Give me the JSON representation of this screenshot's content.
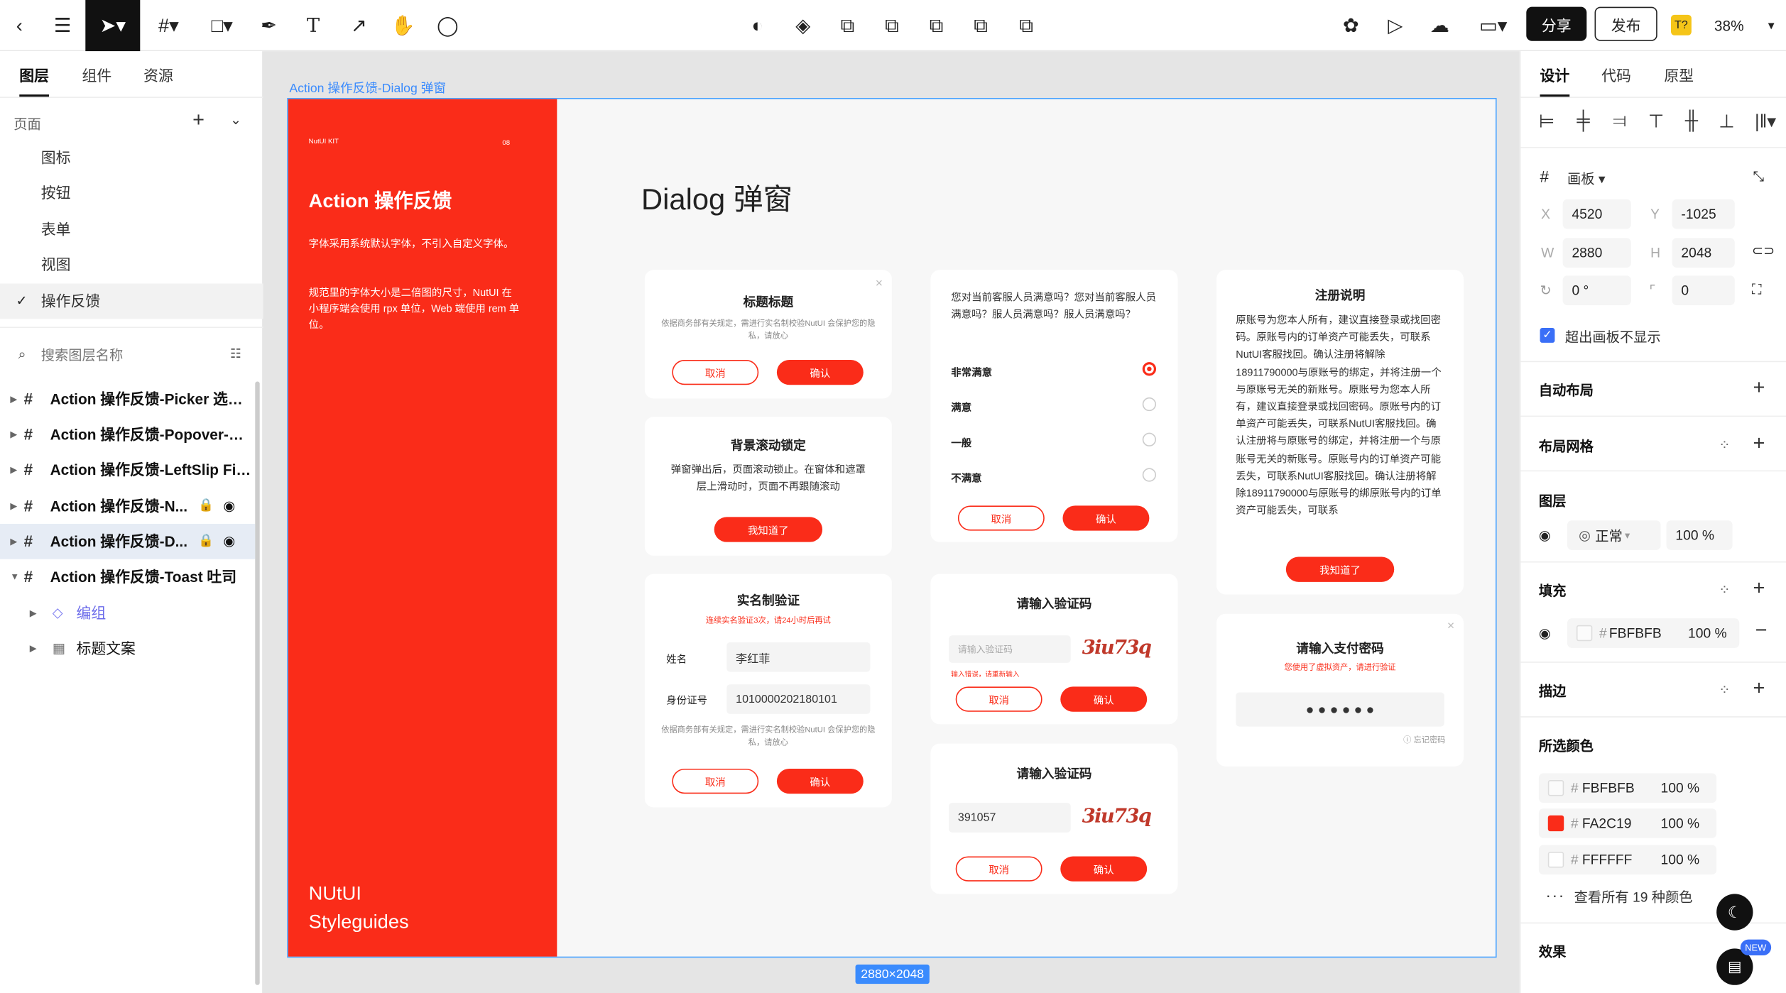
{
  "toolbar": {
    "share": "分享",
    "publish": "发布",
    "zoom": "38%",
    "user_badge": "T?"
  },
  "left": {
    "tabs": [
      "图层",
      "组件",
      "资源"
    ],
    "pages_label": "页面",
    "pages": [
      "图标",
      "按钮",
      "表单",
      "视图",
      "操作反馈"
    ],
    "search_placeholder": "搜索图层名称",
    "layers": [
      "Action 操作反馈-Picker 选择器",
      "Action 操作反馈-Popover-气...",
      "Action 操作反馈-LeftSlip Fixe...",
      "Action 操作反馈-N...",
      "Action 操作反馈-D...",
      "Action 操作反馈-Toast 吐司"
    ],
    "sublayers": [
      "编组",
      "标题文案"
    ]
  },
  "canvas": {
    "board_label": "Action 操作反馈-Dialog 弹窗",
    "size_badge": "2880×2048",
    "red": {
      "kit": "NutUI  KIT",
      "num": "08",
      "title": "Action 操作反馈",
      "desc1": "字体采用系统默认字体，不引入自定义字体。",
      "desc2": "规范里的字体大小是二倍图的尺寸，NutUI 在小程序端会使用 rpx 单位，Web 端使用 rem 单位。",
      "brand1": "NUtUI",
      "brand2": "Styleguides"
    },
    "heading": "Dialog 弹窗",
    "c1": {
      "title": "标题标题",
      "desc": "依据商务部有关规定，需进行实名制校验NutUI 会保护您的隐私，请放心",
      "cancel": "取消",
      "ok": "确认"
    },
    "c2": {
      "title": "背景滚动锁定",
      "desc": "弹窗弹出后，页面滚动锁止。在窗体和遮罩层上滑动时，页面不再跟随滚动",
      "btn": "我知道了"
    },
    "c3": {
      "title": "实名制验证",
      "warn": "连续实名验证3次，请24小时后再试",
      "name_lbl": "姓名",
      "name_val": "李红菲",
      "id_lbl": "身份证号",
      "id_val": "1010000202180101",
      "desc": "依据商务部有关规定，需进行实名制校验NutUI 会保护您的隐私，请放心",
      "cancel": "取消",
      "ok": "确认"
    },
    "c4": {
      "question": "您对当前客服人员满意吗？您对当前客服人员满意吗？服人员满意吗？服人员满意吗？",
      "options": [
        "非常满意",
        "满意",
        "一般",
        "不满意"
      ],
      "cancel": "取消",
      "ok": "确认"
    },
    "c5": {
      "title": "请输入验证码",
      "placeholder": "请输入验证码",
      "captcha": "3iu73q",
      "err": "输入错误，请重新输入",
      "cancel": "取消",
      "ok": "确认"
    },
    "c6": {
      "title": "请输入验证码",
      "value": "391057",
      "captcha": "3iu73q",
      "cancel": "取消",
      "ok": "确认"
    },
    "c7": {
      "title": "注册说明",
      "body": "原账号为您本人所有，建议直接登录或找回密码。原账号内的订单资产可能丢失，可联系NutUI客服找回。确认注册将解除18911790000与原账号的绑定，并将注册一个与原账号无关的新账号。原账号为您本人所有，建议直接登录或找回密码。原账号内的订单资产可能丢失，可联系NutUI客服找回。确认注册将与原账号的绑定，并将注册一个与原账号无关的新账号。原账号内的订单资产可能丢失，可联系NutUI客服找回。确认注册将解除18911790000与原账号的绑原账号内的订单资产可能丢失，可联系",
      "btn": "我知道了"
    },
    "c8": {
      "title": "请输入支付密码",
      "warn": "您使用了虚拟资产，请进行验证",
      "forgot": "忘记密码"
    }
  },
  "right": {
    "tabs": [
      "设计",
      "代码",
      "原型"
    ],
    "frame_label": "画板",
    "x_lbl": "X",
    "x": "4520",
    "y_lbl": "Y",
    "y": "-1025",
    "w_lbl": "W",
    "w": "2880",
    "h_lbl": "H",
    "h": "2048",
    "rot": "0 °",
    "radius": "0",
    "clip": "超出画板不显示",
    "auto_layout": "自动布局",
    "grid": "布局网格",
    "layer": "图层",
    "blend": "正常",
    "opacity": "100 %",
    "fill": "填充",
    "fill_hex": "FBFBFB",
    "fill_op": "100 %",
    "stroke": "描边",
    "sel_colors": "所选颜色",
    "colors": [
      {
        "hex": "FBFBFB",
        "op": "100 %",
        "color": "#FBFBFB"
      },
      {
        "hex": "FA2C19",
        "op": "100 %",
        "color": "#FA2C19"
      },
      {
        "hex": "FFFFFF",
        "op": "100 %",
        "color": "#FFFFFF"
      }
    ],
    "see_all": "查看所有 19 种颜色",
    "effects": "效果",
    "new_badge": "NEW"
  }
}
